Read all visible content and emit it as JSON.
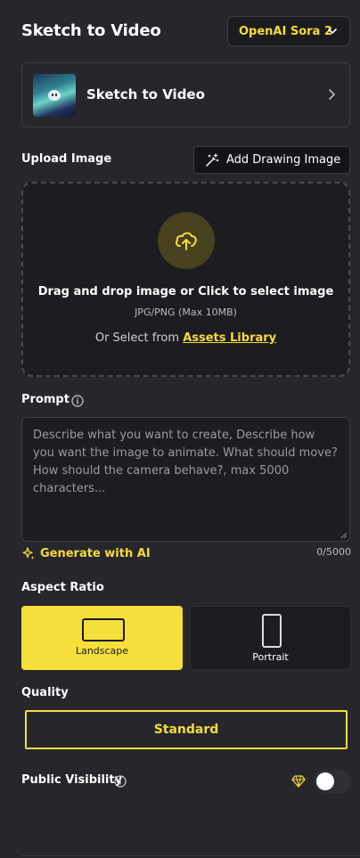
{
  "header": {
    "title": "Sketch to Video",
    "model_select": "OpenAI Sora 2"
  },
  "tool_card": {
    "name": "Sketch to Video"
  },
  "upload": {
    "label": "Upload Image",
    "add_drawing_label": "Add Drawing Image",
    "drop_main": "Drag and drop image or Click to select image",
    "drop_sub": "JPG/PNG (Max 10MB)",
    "or_select": "Or Select from",
    "assets_link": "Assets Library"
  },
  "prompt": {
    "label": "Prompt",
    "placeholder": "Describe what you want to create, Describe how you want the image to animate. What should move? How should the camera behave?, max 5000 characters...",
    "generate_label": "Generate with AI",
    "char_count": "0/5000"
  },
  "aspect_ratio": {
    "label": "Aspect Ratio",
    "options": [
      {
        "label": "Landscape",
        "selected": true
      },
      {
        "label": "Portrait",
        "selected": false
      }
    ]
  },
  "quality": {
    "label": "Quality",
    "selected": "Standard"
  },
  "visibility": {
    "label": "Public Visibility",
    "enabled": false
  },
  "colors": {
    "background": "#26262c",
    "accent": "#f5dc3a",
    "panel": "#1c1c21",
    "border": "#3c3c44"
  },
  "icons": [
    "chevron-down-icon",
    "chevron-right-icon",
    "magic-wand-icon",
    "upload-cloud-icon",
    "info-icon",
    "sparkles-icon",
    "diamond-icon"
  ]
}
